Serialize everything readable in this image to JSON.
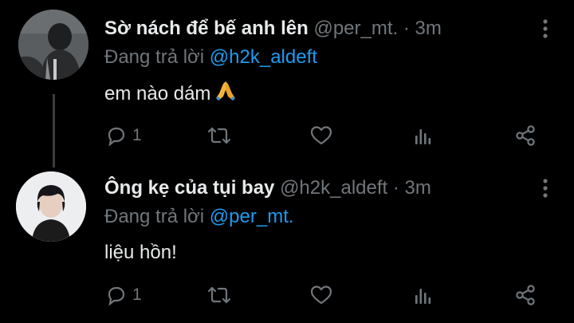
{
  "tweets": [
    {
      "display_name": "Sờ nách để bế anh lên",
      "handle": "@per_mt.",
      "separator": "·",
      "time": "3m",
      "replying_prefix": "Đang trả lời",
      "replying_to": "@h2k_aldeft",
      "text": "em nào dám",
      "emoji": "🙏",
      "reply_count": "1",
      "retweet_count": "",
      "like_count": "",
      "icons": [
        "comment-icon",
        "retweet-icon",
        "heart-icon",
        "views-icon",
        "share-icon",
        "more-options-icon"
      ]
    },
    {
      "display_name": "Ông kẹ của tụi bay",
      "handle": "@h2k_aldeft",
      "separator": "·",
      "time": "3m",
      "replying_prefix": "Đang trả lời",
      "replying_to": "@per_mt.",
      "text": "liệu hồn!",
      "reply_count": "1",
      "retweet_count": "",
      "like_count": "",
      "icons": [
        "comment-icon",
        "retweet-icon",
        "heart-icon",
        "views-icon",
        "share-icon",
        "more-options-icon"
      ]
    }
  ],
  "colors": {
    "background": "#000000",
    "text_primary": "#e7e9ea",
    "text_secondary": "#71767b",
    "accent": "#1d9bf0",
    "thread_line": "#3a3d41"
  }
}
